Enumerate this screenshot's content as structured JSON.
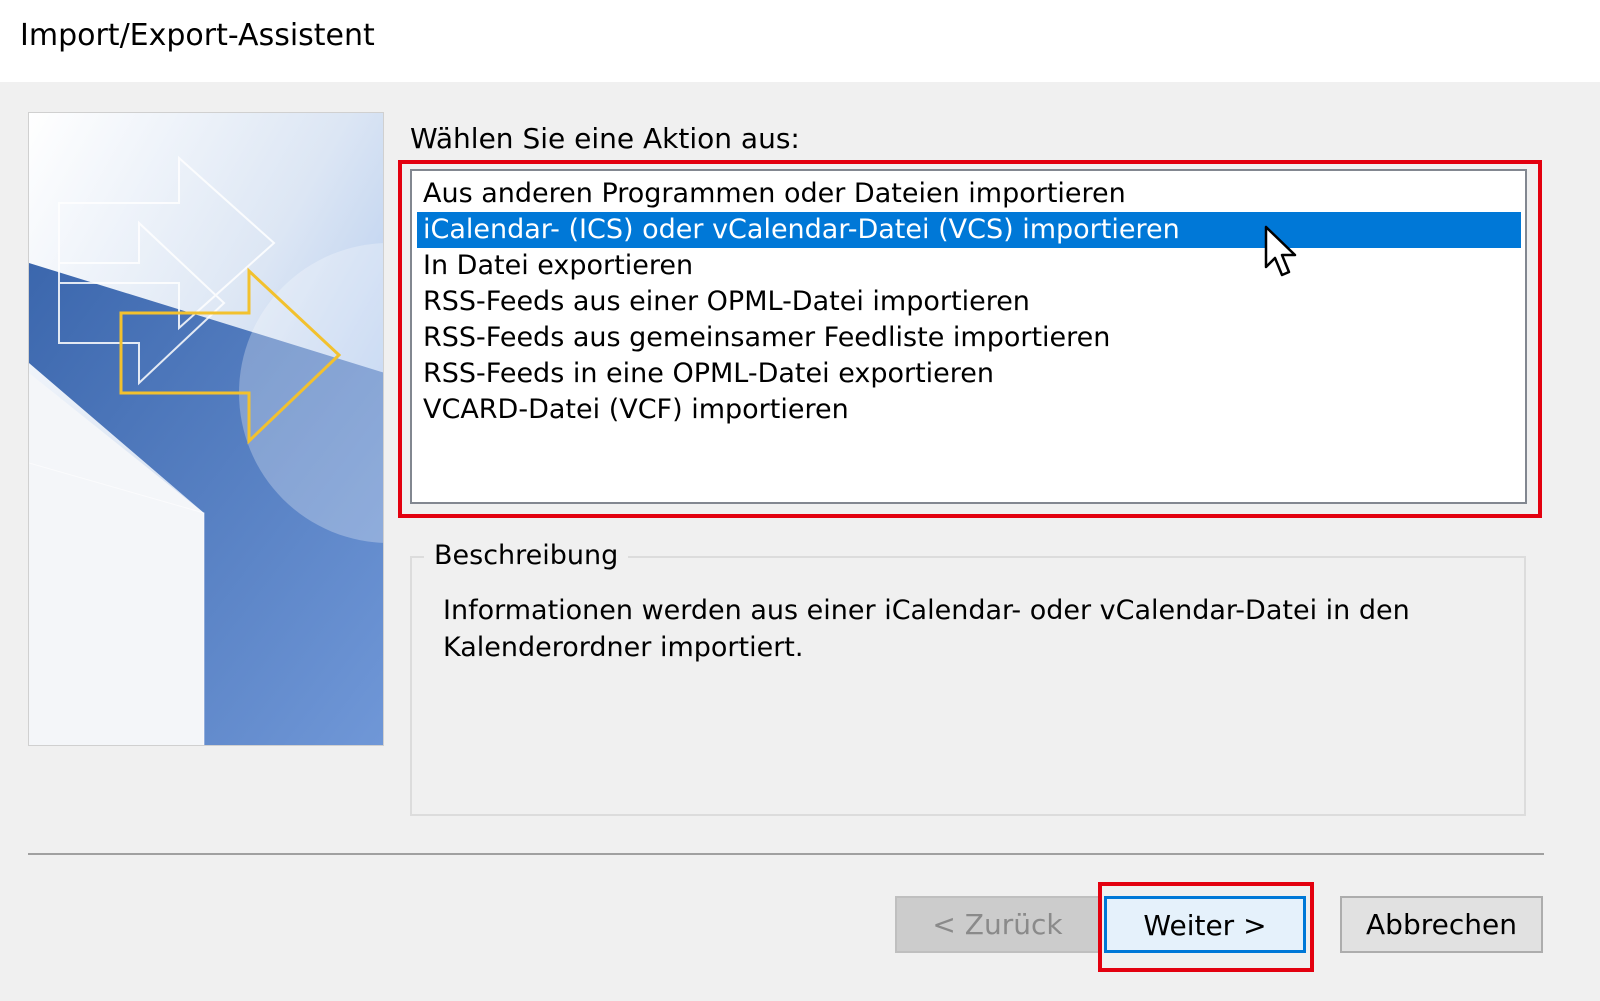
{
  "window": {
    "title": "Import/Export-Assistent"
  },
  "prompt": "Wählen Sie eine Aktion aus:",
  "actions": [
    {
      "label": "Aus anderen Programmen oder Dateien importieren",
      "selected": false
    },
    {
      "label": "iCalendar- (ICS) oder vCalendar-Datei (VCS) importieren",
      "selected": true
    },
    {
      "label": "In Datei exportieren",
      "selected": false
    },
    {
      "label": "RSS-Feeds aus einer OPML-Datei importieren",
      "selected": false
    },
    {
      "label": "RSS-Feeds aus gemeinsamer Feedliste importieren",
      "selected": false
    },
    {
      "label": "RSS-Feeds in eine OPML-Datei exportieren",
      "selected": false
    },
    {
      "label": "VCARD-Datei (VCF) importieren",
      "selected": false
    }
  ],
  "description": {
    "legend": "Beschreibung",
    "text": "Informationen werden aus einer iCalendar- oder vCalendar-Datei in den Kalenderordner importiert."
  },
  "buttons": {
    "back": "< Zurück",
    "next": "Weiter >",
    "cancel": "Abbrechen"
  },
  "colors": {
    "selection": "#0078d7",
    "highlight_frame": "#e3000f",
    "arrow_accent": "#f2c12e"
  },
  "icons": {
    "side_image": "import-export-arrow-graphic",
    "cursor": "mouse-pointer-icon"
  }
}
